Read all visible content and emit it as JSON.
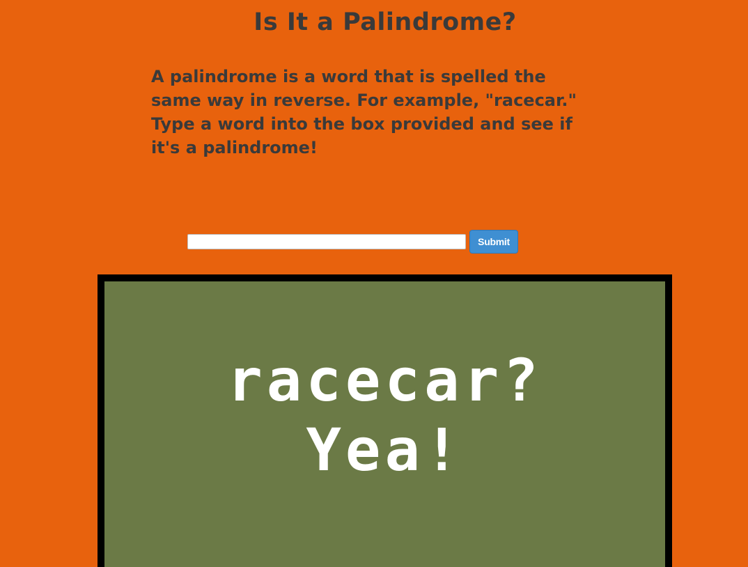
{
  "header": {
    "title": "Is It a Palindrome?"
  },
  "intro": {
    "text": "A palindrome is a word that is spelled the same way in reverse. For example, \"racecar.\" Type a word into the box provided and see if it's a palindrome!"
  },
  "form": {
    "input_value": "",
    "input_placeholder": "",
    "submit_label": "Submit"
  },
  "result": {
    "line1": "racecar?",
    "line2": "Yea!"
  },
  "colors": {
    "background": "#e8620d",
    "text": "#3a3a3a",
    "screen": "#6b7a46",
    "frame": "#000000",
    "button": "#3f8fd2"
  }
}
